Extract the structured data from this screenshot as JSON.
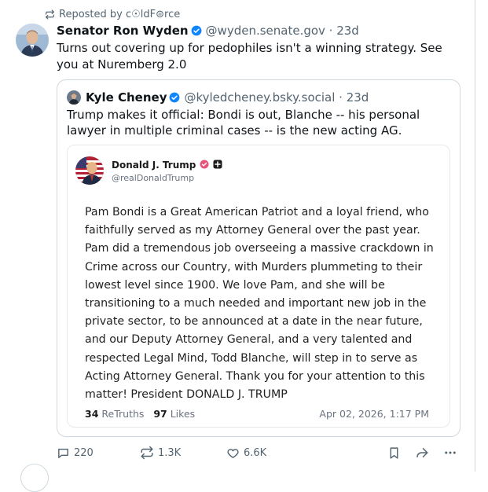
{
  "repost": {
    "label": "Reposted by c☉ldF⊜rce",
    "icon": "repost-icon"
  },
  "post": {
    "author_name": "Senator Ron Wyden",
    "author_handle": "@wyden.senate.gov · 23d",
    "text": "Turns out covering up for pedophiles isn't a winning strategy. See you at Nuremberg 2.0",
    "verified_icon": "verified-badge-icon"
  },
  "quote": {
    "author_name": "Kyle Cheney",
    "author_handle": "@kyledcheney.bsky.social · 23d",
    "text": "Trump makes it official: Bondi is out, Blanche -- his personal lawyer in multiple criminal cases -- is the new acting AG."
  },
  "embed": {
    "author_name": "Donald J. Trump",
    "author_handle": "@realDonaldTrump",
    "body": "Pam Bondi is a Great American Patriot and a loyal friend, who faithfully served as my Attorney General over the past year. Pam did a tremendous job overseeing a massive crackdown in Crime across our Country, with Murders plummeting to their lowest level since 1900. We love Pam, and she will be transitioning to a much needed and important new job in the private sector, to be announced at a date in the near future, and our Deputy Attorney General, and a very talented and respected Legal Mind, Todd Blanche, will step in to serve as Acting Attorney General. Thank you for your attention to this matter! President DONALD J. TRUMP",
    "retruths_count": "34",
    "retruths_label": "ReTruths",
    "likes_count": "97",
    "likes_label": "Likes",
    "date": "Apr 02, 2026, 1:17 PM"
  },
  "actions": {
    "replies": "220",
    "reposts": "1.3K",
    "likes": "6.6K"
  },
  "colors": {
    "accent": "#1185fe",
    "muted": "#536471",
    "border": "#cfd9de"
  }
}
